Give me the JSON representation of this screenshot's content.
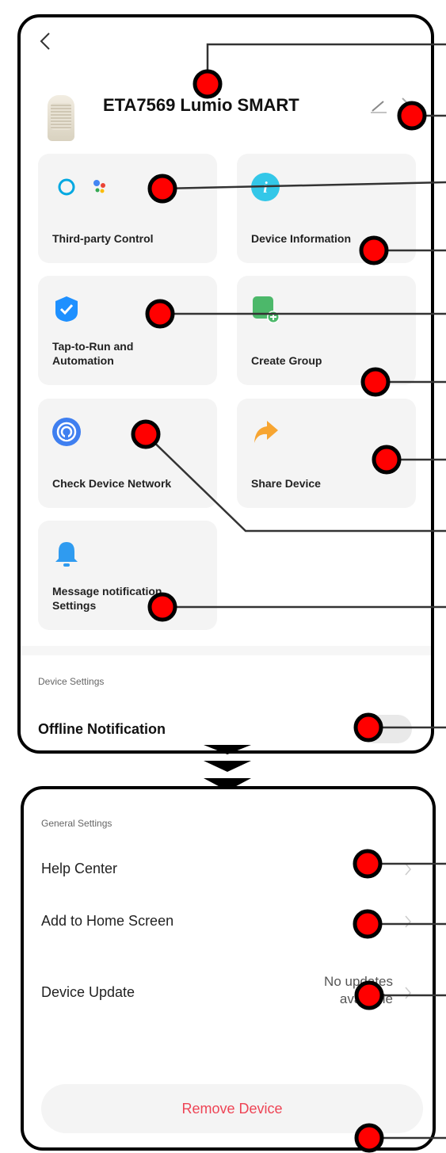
{
  "header": {
    "device_name": "ETA7569 Lumio SMART"
  },
  "tiles": [
    {
      "label": "Third-party Control"
    },
    {
      "label": "Device Information"
    },
    {
      "label": "Tap-to-Run and\nAutomation"
    },
    {
      "label": "Create Group"
    },
    {
      "label": "Check Device Network"
    },
    {
      "label": "Share Device"
    },
    {
      "label": "Message notification\nSettings"
    }
  ],
  "device_settings": {
    "section_title": "Device Settings",
    "offline_label": "Offline Notification"
  },
  "general_settings": {
    "section_title": "General Settings",
    "rows": [
      {
        "label": "Help Center"
      },
      {
        "label": "Add to Home Screen"
      },
      {
        "label": "Device Update",
        "value": "No updates\navailable"
      }
    ],
    "remove_label": "Remove Device"
  },
  "colors": {
    "accent_red": "#ff0000",
    "remove_text": "#ee4455",
    "alexa_blue": "#00a8e1",
    "tap_blue": "#1e90ff",
    "group_green": "#3cb371",
    "share_orange": "#f7a531",
    "bell_blue": "#2f9bf0"
  }
}
